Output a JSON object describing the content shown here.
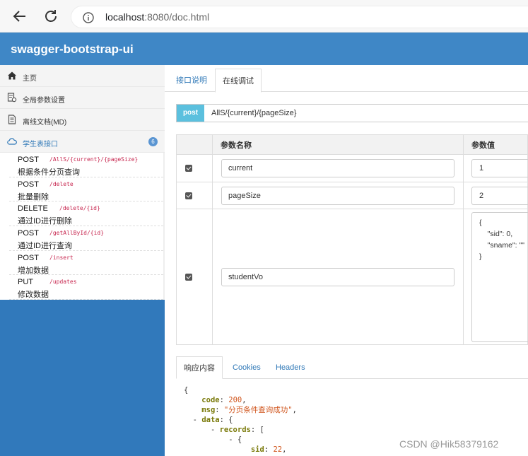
{
  "browser": {
    "url_host": "localhost",
    "url_rest": ":8080/doc.html"
  },
  "header": {
    "title": "swagger-bootstrap-ui"
  },
  "sidebar": {
    "items": [
      {
        "label": "主页",
        "icon": "home-icon"
      },
      {
        "label": "全局参数设置",
        "icon": "settings-doc-icon"
      },
      {
        "label": "离线文档(MD)",
        "icon": "document-icon"
      },
      {
        "label": "学生表接口",
        "icon": "cloud-icon",
        "badge": "6"
      }
    ],
    "apis": [
      {
        "method": "POST",
        "path": "/AllS/{current}/{pageSize}",
        "desc": "根据条件分页查询"
      },
      {
        "method": "POST",
        "path": "/delete",
        "desc": "批量删除"
      },
      {
        "method": "DELETE",
        "path": "/delete/{id}",
        "desc": "通过ID进行删除"
      },
      {
        "method": "POST",
        "path": "/getAllById/{id}",
        "desc": "通过ID进行查询"
      },
      {
        "method": "POST",
        "path": "/insert",
        "desc": "增加数据"
      },
      {
        "method": "PUT",
        "path": "/updates",
        "desc": "修改数据"
      }
    ]
  },
  "main": {
    "tabs": [
      "接口说明",
      "在线调试"
    ],
    "method": "post",
    "path": "AllS/{current}/{pageSize}",
    "table_headers": [
      "参数名称",
      "参数值"
    ],
    "params": [
      {
        "name": "current",
        "value": "1"
      },
      {
        "name": "pageSize",
        "value": "2"
      },
      {
        "name": "studentVo",
        "value": "{\n    \"sid\": 0,\n    \"sname\": \"\"\n}"
      }
    ],
    "response_tabs": [
      "响应内容",
      "Cookies",
      "Headers"
    ],
    "response": {
      "code_key": "code",
      "code_val": "200",
      "msg_key": "msg",
      "msg_val": "\"分页条件查询成功\"",
      "data_key": "data",
      "records_key": "records",
      "sid_key": "sid",
      "sid_val": "22"
    }
  },
  "watermark": "CSDN @Hik58379162",
  "colors": {
    "header": "#3f87c6",
    "sidebar": "#3179bb",
    "post_pill": "#5bc0de",
    "api_path": "#c7254e"
  }
}
